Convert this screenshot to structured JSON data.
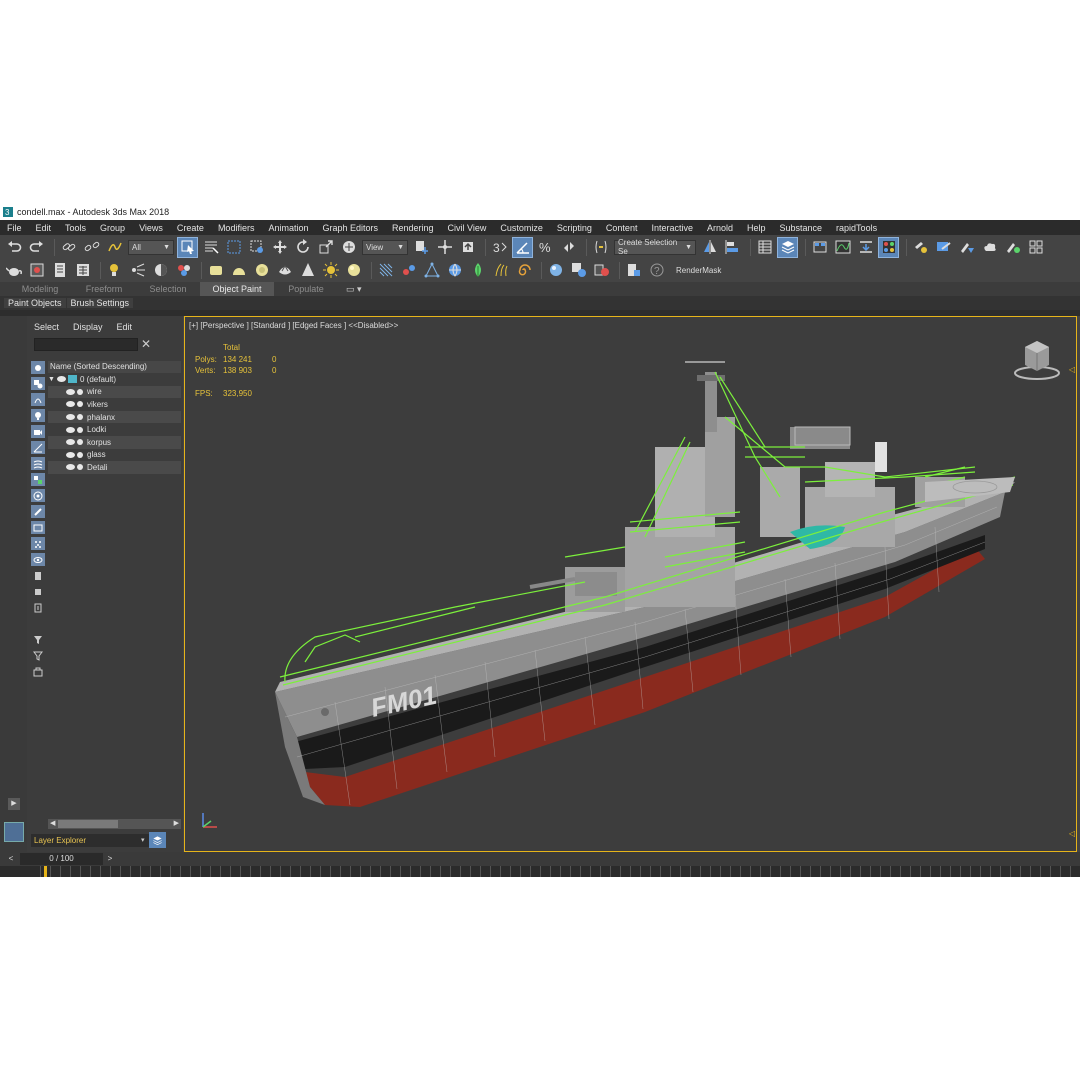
{
  "window": {
    "title": "condell.max - Autodesk 3ds Max 2018"
  },
  "menu": [
    "File",
    "Edit",
    "Tools",
    "Group",
    "Views",
    "Create",
    "Modifiers",
    "Animation",
    "Graph Editors",
    "Rendering",
    "Civil View",
    "Customize",
    "Scripting",
    "Content",
    "Interactive",
    "Arnold",
    "Help",
    "Substance",
    "rapidTools"
  ],
  "toolbar": {
    "filter_value": "All",
    "refcoord_value": "View",
    "selection_set_value": "Create Selection Se",
    "render_mask_label": "RenderMask"
  },
  "ribbon": {
    "tabs": [
      "Modeling",
      "Freeform",
      "Selection",
      "Object Paint",
      "Populate"
    ],
    "active_tab": "Object Paint",
    "subtabs": [
      "Paint Objects",
      "Brush Settings"
    ]
  },
  "scene_explorer": {
    "menu": [
      "Select",
      "Display",
      "Edit"
    ],
    "column_header": "Name (Sorted Descending)",
    "root_layer": "0 (default)",
    "items": [
      "wire",
      "vikers",
      "phalanx",
      "Lodki",
      "korpus",
      "glass",
      "Detali"
    ],
    "footer_dropdown": "Layer Explorer"
  },
  "viewport": {
    "label": "[+] [Perspective ] [Standard ] [Edged Faces ]  <<Disabled>>",
    "stats": {
      "header": "Total",
      "polys_label": "Polys:",
      "polys_value": "134 241",
      "polys_sel": "0",
      "verts_label": "Verts:",
      "verts_value": "138 903",
      "verts_sel": "0",
      "fps_label": "FPS:",
      "fps_value": "323,950"
    },
    "hull_marking": "FM01"
  },
  "timeline": {
    "frame_label": "0 / 100"
  },
  "colors": {
    "accent": "#5b86b8",
    "viewport_border": "#e6b41a",
    "stats_text": "#e6c23a",
    "wireframe": "#7cf03c",
    "hull_red": "#8a2a1e",
    "hull_grey": "#8e8e8e"
  }
}
